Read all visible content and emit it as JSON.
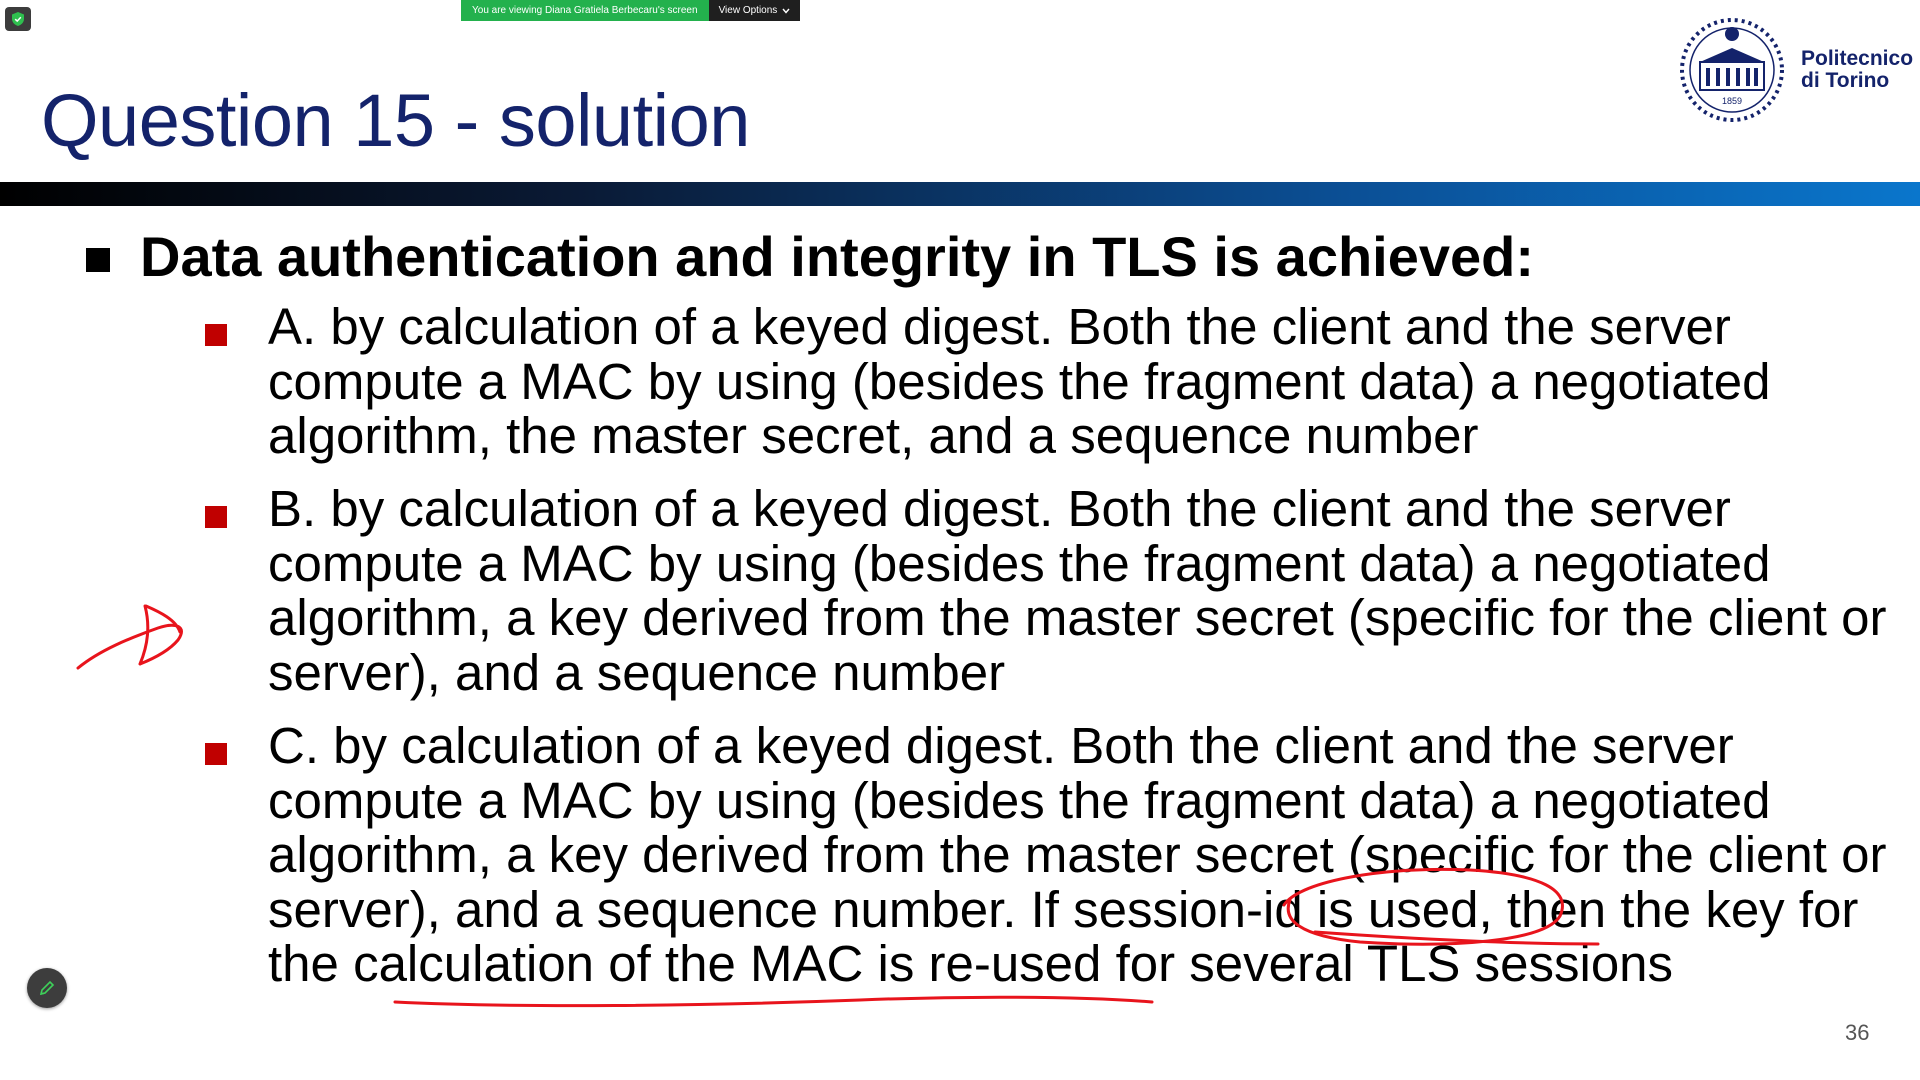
{
  "share_banner": {
    "text": "You are viewing Diana Gratiela Berbecaru's screen",
    "view_options_label": "View Options"
  },
  "slide": {
    "title": "Question 15 - solution",
    "logo": {
      "line1": "Politecnico",
      "line2": "di Torino",
      "year": "1859"
    },
    "question": "Data authentication and integrity in TLS is achieved:",
    "options": [
      {
        "text": "A. by calculation of a keyed digest. Both the client and the server compute a MAC by using (besides the fragment data) a negotiated algorithm, the master secret, and a sequence number"
      },
      {
        "text": "B. by calculation of a keyed digest. Both the client and the server compute a MAC by using (besides the fragment data) a negotiated algorithm, a key derived from the master secret (specific for the client or server), and a sequence number"
      },
      {
        "text": "C. by calculation of a keyed digest. Both the client and the server compute a MAC by using (besides the fragment data) a negotiated algorithm, a key derived from the master secret (specific for the client or server), and a sequence number. If session-id is used, then the key for the calculation of the MAC is re-used for several TLS sessions"
      }
    ],
    "page_number": "36"
  },
  "annotation_color": "#e8141c",
  "colors": {
    "title": "#14236b",
    "bullet_square": "#c00000",
    "share_green": "#23b14d"
  },
  "icons": {
    "shield": "shield-icon",
    "chevron": "chevron-down-icon",
    "pen": "pen-icon"
  }
}
